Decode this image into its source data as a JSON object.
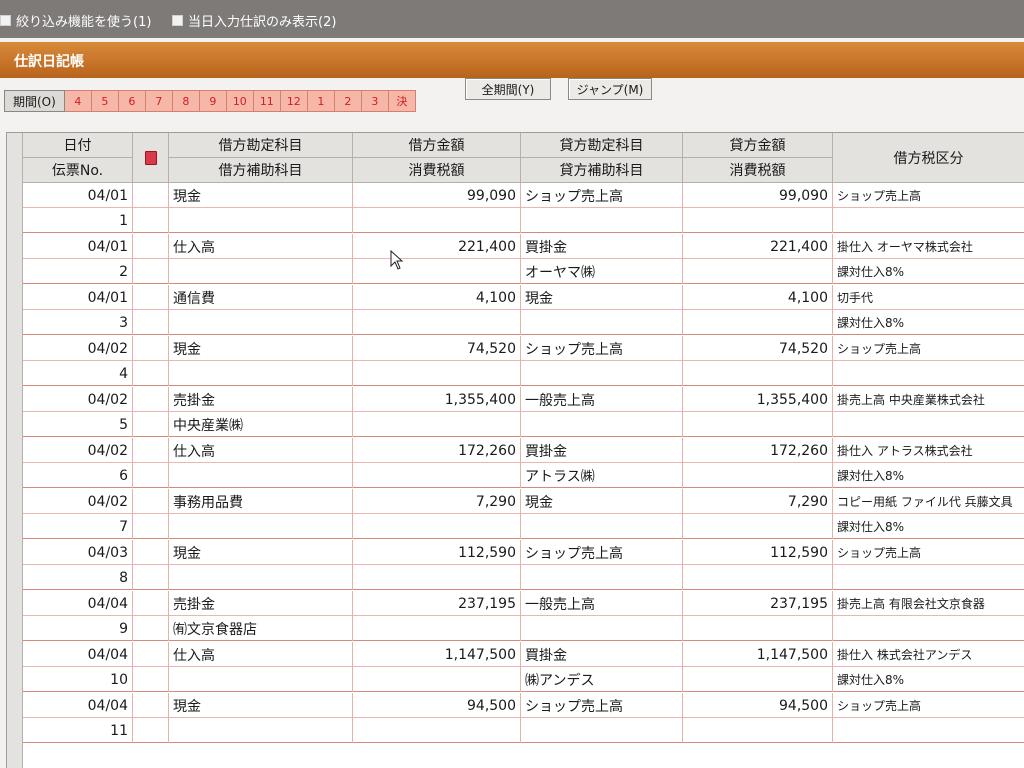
{
  "options": {
    "filter_label": "絞り込み機能を使う(1)",
    "today_only_label": "当日入力仕訳のみ表示(2)"
  },
  "window": {
    "title": "仕訳日記帳"
  },
  "period": {
    "label": "期間(O)",
    "months": [
      "4",
      "5",
      "6",
      "7",
      "8",
      "9",
      "10",
      "11",
      "12",
      "1",
      "2",
      "3",
      "決"
    ],
    "all_period_label": "全期間(Y)",
    "jump_label": "ジャンプ(M)"
  },
  "columns": {
    "date": "日付",
    "slip_no": "伝票No.",
    "debit_account": "借方勘定科目",
    "debit_sub_account": "借方補助科目",
    "debit_amount": "借方金額",
    "consumption_tax": "消費税額",
    "credit_account": "貸方勘定科目",
    "credit_sub_account": "貸方補助科目",
    "credit_amount": "貸方金額",
    "credit_tax": "消費税額",
    "debit_tax_class": "借方税区分"
  },
  "rows": [
    {
      "date": "04/01",
      "no": "1",
      "debit_account": "現金",
      "debit_sub": "",
      "debit_amount": "99,090",
      "debit_tax": "",
      "credit_account": "ショップ売上高",
      "credit_sub": "",
      "credit_amount": "99,090",
      "credit_tax": "",
      "tax_class": "ショップ売上高",
      "tax_class2": ""
    },
    {
      "date": "04/01",
      "no": "2",
      "debit_account": "仕入高",
      "debit_sub": "",
      "debit_amount": "221,400",
      "debit_tax": "",
      "credit_account": "買掛金",
      "credit_sub": "オーヤマ㈱",
      "credit_amount": "221,400",
      "credit_tax": "",
      "tax_class": "掛仕入 オーヤマ株式会社",
      "tax_class2": "課対仕入8%"
    },
    {
      "date": "04/01",
      "no": "3",
      "debit_account": "通信費",
      "debit_sub": "",
      "debit_amount": "4,100",
      "debit_tax": "",
      "credit_account": "現金",
      "credit_sub": "",
      "credit_amount": "4,100",
      "credit_tax": "",
      "tax_class": "切手代",
      "tax_class2": "課対仕入8%"
    },
    {
      "date": "04/02",
      "no": "4",
      "debit_account": "現金",
      "debit_sub": "",
      "debit_amount": "74,520",
      "debit_tax": "",
      "credit_account": "ショップ売上高",
      "credit_sub": "",
      "credit_amount": "74,520",
      "credit_tax": "",
      "tax_class": "ショップ売上高",
      "tax_class2": ""
    },
    {
      "date": "04/02",
      "no": "5",
      "debit_account": "売掛金",
      "debit_sub": "中央産業㈱",
      "debit_amount": "1,355,400",
      "debit_tax": "",
      "credit_account": "一般売上高",
      "credit_sub": "",
      "credit_amount": "1,355,400",
      "credit_tax": "",
      "tax_class": "掛売上高 中央産業株式会社",
      "tax_class2": ""
    },
    {
      "date": "04/02",
      "no": "6",
      "debit_account": "仕入高",
      "debit_sub": "",
      "debit_amount": "172,260",
      "debit_tax": "",
      "credit_account": "買掛金",
      "credit_sub": "アトラス㈱",
      "credit_amount": "172,260",
      "credit_tax": "",
      "tax_class": "掛仕入 アトラス株式会社",
      "tax_class2": "課対仕入8%"
    },
    {
      "date": "04/02",
      "no": "7",
      "debit_account": "事務用品費",
      "debit_sub": "",
      "debit_amount": "7,290",
      "debit_tax": "",
      "credit_account": "現金",
      "credit_sub": "",
      "credit_amount": "7,290",
      "credit_tax": "",
      "tax_class": "コピー用紙 ファイル代 兵藤文具",
      "tax_class2": "課対仕入8%"
    },
    {
      "date": "04/03",
      "no": "8",
      "debit_account": "現金",
      "debit_sub": "",
      "debit_amount": "112,590",
      "debit_tax": "",
      "credit_account": "ショップ売上高",
      "credit_sub": "",
      "credit_amount": "112,590",
      "credit_tax": "",
      "tax_class": "ショップ売上高",
      "tax_class2": ""
    },
    {
      "date": "04/04",
      "no": "9",
      "debit_account": "売掛金",
      "debit_sub": "㈲文京食器店",
      "debit_amount": "237,195",
      "debit_tax": "",
      "credit_account": "一般売上高",
      "credit_sub": "",
      "credit_amount": "237,195",
      "credit_tax": "",
      "tax_class": "掛売上高 有限会社文京食器",
      "tax_class2": ""
    },
    {
      "date": "04/04",
      "no": "10",
      "debit_account": "仕入高",
      "debit_sub": "",
      "debit_amount": "1,147,500",
      "debit_tax": "",
      "credit_account": "買掛金",
      "credit_sub": "㈱アンデス",
      "credit_amount": "1,147,500",
      "credit_tax": "",
      "tax_class": "掛仕入 株式会社アンデス",
      "tax_class2": "課対仕入8%"
    },
    {
      "date": "04/04",
      "no": "11",
      "debit_account": "現金",
      "debit_sub": "",
      "debit_amount": "94,500",
      "debit_tax": "",
      "credit_account": "ショップ売上高",
      "credit_sub": "",
      "credit_amount": "94,500",
      "credit_tax": "",
      "tax_class": "ショップ売上高",
      "tax_class2": ""
    }
  ]
}
